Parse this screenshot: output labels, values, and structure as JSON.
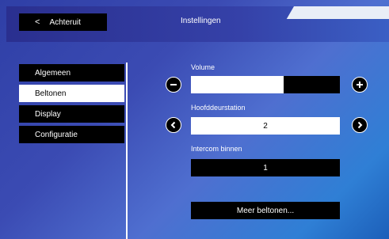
{
  "header": {
    "back_icon": "‹",
    "back_label": "Achteruit",
    "title": "Instellingen"
  },
  "sidebar": {
    "items": [
      {
        "label": "Algemeen"
      },
      {
        "label": "Beltonen"
      },
      {
        "label": "Display"
      },
      {
        "label": "Configuratie"
      }
    ]
  },
  "settings": {
    "volume_label": "Volume",
    "volume_level_percent": 62,
    "hoofddeur_label": "Hoofddeurstation",
    "hoofddeur_value": "2",
    "intercom_label": "Intercom binnen",
    "intercom_value": "1",
    "more_label": "Meer beltonen..."
  }
}
